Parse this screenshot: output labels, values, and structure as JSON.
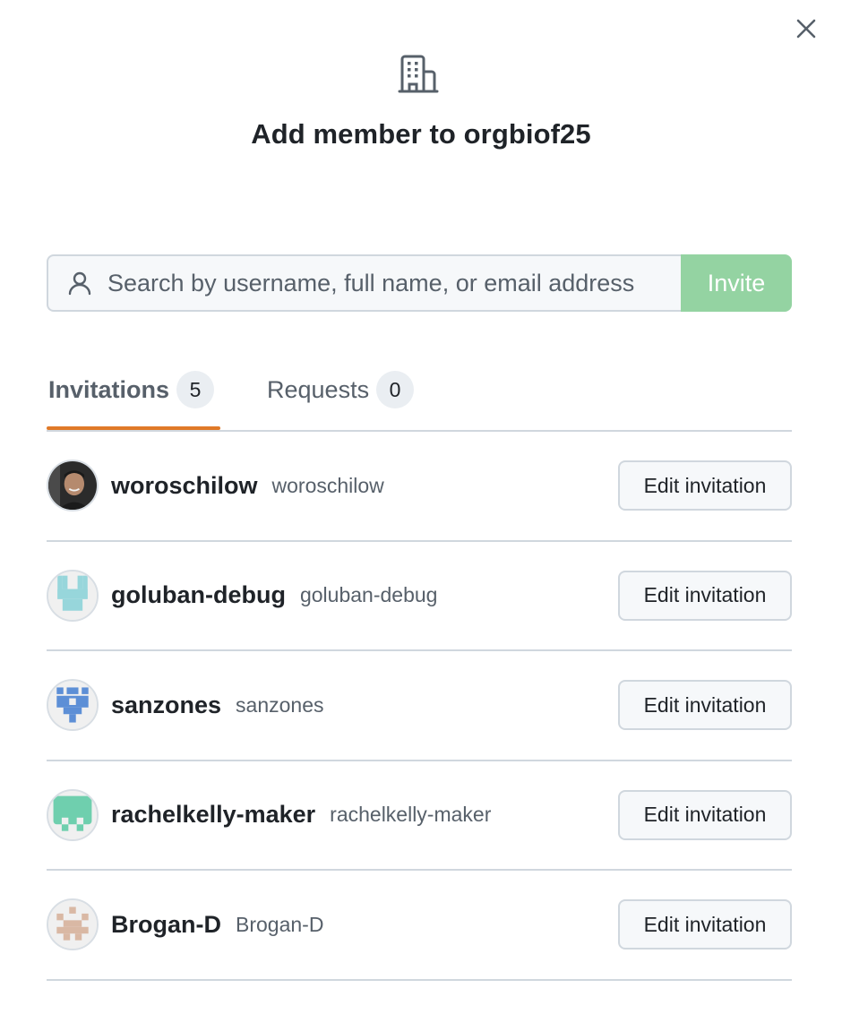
{
  "dialog": {
    "close_label": "×",
    "title": "Add member to orgbiof25"
  },
  "search": {
    "placeholder": "Search by username, full name, or email address",
    "value": ""
  },
  "invite_label": "Invite",
  "colors": {
    "invite_bg": "#94d3a2",
    "tab_underline": "#e07928",
    "border": "#d0d7de"
  },
  "tabs": [
    {
      "label": "Invitations",
      "count": "5",
      "selected": true
    },
    {
      "label": "Requests",
      "count": "0",
      "selected": false
    }
  ],
  "invitations": [
    {
      "login": "woroschilow",
      "handle": "woroschilow",
      "button": "Edit invitation",
      "avatar": "photo"
    },
    {
      "login": "goluban-debug",
      "handle": "goluban-debug",
      "button": "Edit invitation",
      "avatar": "identicon-cyan"
    },
    {
      "login": "sanzones",
      "handle": "sanzones",
      "button": "Edit invitation",
      "avatar": "identicon-blue"
    },
    {
      "login": "rachelkelly-maker",
      "handle": "rachelkelly-maker",
      "button": "Edit invitation",
      "avatar": "identicon-green"
    },
    {
      "login": "Brogan-D",
      "handle": "Brogan-D",
      "button": "Edit invitation",
      "avatar": "identicon-tan"
    }
  ]
}
